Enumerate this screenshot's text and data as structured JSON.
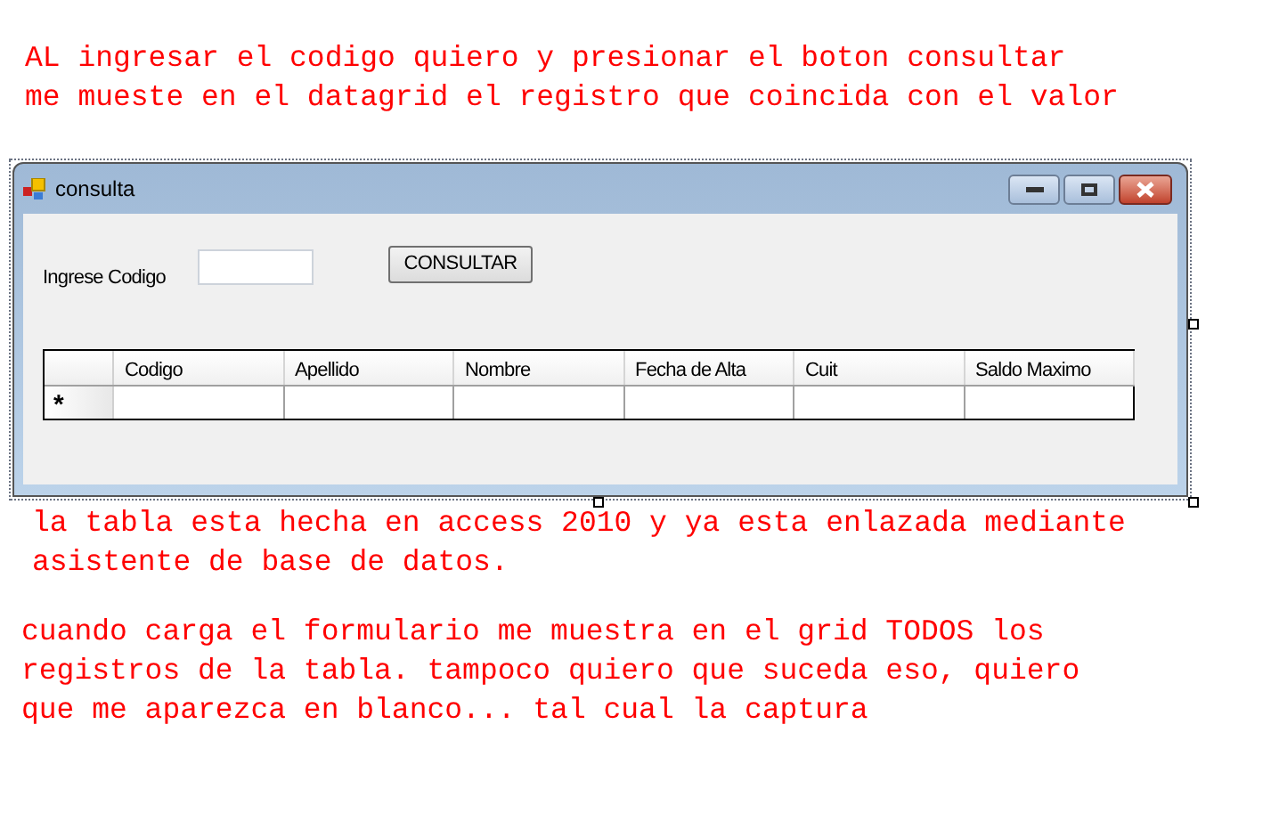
{
  "notes_top": [
    "AL ingresar el codigo quiero y presionar el boton consultar",
    "me mueste en el datagrid el registro que coincida con el valor"
  ],
  "window": {
    "title": "consulta",
    "label": "Ingrese Codigo",
    "button": "CONSULTAR"
  },
  "grid": {
    "columns": [
      "Codigo",
      "Apellido",
      "Nombre",
      "Fecha de Alta",
      "Cuit",
      "Saldo Maximo"
    ],
    "rows": [
      {
        "marker": "*"
      }
    ]
  },
  "notes_middle": [
    "la tabla esta hecha en access 2010 y ya esta enlazada mediante",
    "asistente de base de datos."
  ],
  "notes_bottom": [
    "cuando carga el formulario me muestra en el grid TODOS los",
    "registros de la tabla. tampoco quiero que suceda eso, quiero",
    "que me aparezca en blanco... tal cual la captura"
  ]
}
